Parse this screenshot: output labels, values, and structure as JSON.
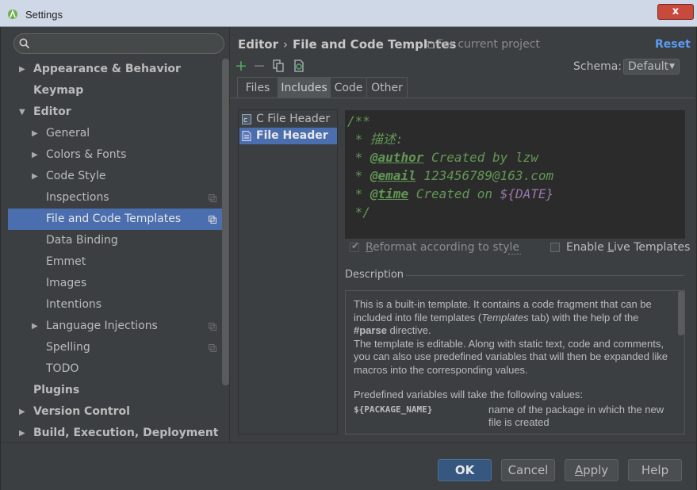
{
  "window": {
    "title": "Settings",
    "close_glyph": "x"
  },
  "search": {
    "placeholder": "",
    "value": ""
  },
  "tree": [
    {
      "label": "Appearance & Behavior",
      "bold": true,
      "arrow": "right"
    },
    {
      "label": "Keymap",
      "bold": true,
      "arrow": ""
    },
    {
      "label": "Editor",
      "bold": true,
      "arrow": "down"
    },
    {
      "label": "General",
      "bold": false,
      "arrow": "right"
    },
    {
      "label": "Colors & Fonts",
      "bold": false,
      "arrow": "right"
    },
    {
      "label": "Code Style",
      "bold": false,
      "arrow": "right"
    },
    {
      "label": "Inspections",
      "bold": false,
      "arrow": "",
      "project_icon": true
    },
    {
      "label": "File and Code Templates",
      "bold": false,
      "arrow": "",
      "project_icon": true,
      "selected": true
    },
    {
      "label": "Data Binding",
      "bold": false,
      "arrow": ""
    },
    {
      "label": "Emmet",
      "bold": false,
      "arrow": ""
    },
    {
      "label": "Images",
      "bold": false,
      "arrow": ""
    },
    {
      "label": "Intentions",
      "bold": false,
      "arrow": ""
    },
    {
      "label": "Language Injections",
      "bold": false,
      "arrow": "right",
      "project_icon": true
    },
    {
      "label": "Spelling",
      "bold": false,
      "arrow": "",
      "project_icon": true
    },
    {
      "label": "TODO",
      "bold": false,
      "arrow": ""
    },
    {
      "label": "Plugins",
      "bold": true,
      "arrow": ""
    },
    {
      "label": "Version Control",
      "bold": true,
      "arrow": "right"
    },
    {
      "label": "Build, Execution, Deployment",
      "bold": true,
      "arrow": "right"
    }
  ],
  "header": {
    "crumb_1": "Editor",
    "crumb_sep": "›",
    "crumb_2": "File and Code Templates",
    "scope": "For current project",
    "reset": "Reset"
  },
  "toolbar": {
    "add": "+",
    "remove": "−"
  },
  "schema": {
    "label": "Schema:",
    "value": "Default"
  },
  "tabs": [
    "Files",
    "Includes",
    "Code",
    "Other"
  ],
  "active_tab": "Includes",
  "templates": [
    {
      "label": "C File Header",
      "selected": false
    },
    {
      "label": "File Header",
      "selected": true
    }
  ],
  "editor": {
    "line1": "/**",
    "line2_prefix": " * ",
    "line2_text": "描述:",
    "line3_tag": "@author",
    "line3_text": " Created by lzw",
    "line4_tag": "@email",
    "line4_text": " 123456789@163.com",
    "line5_tag": "@time",
    "line5_text": " Created on ",
    "line5_var": "${DATE}",
    "line6": " */",
    "line_prefix": " * "
  },
  "options": {
    "reformat_label_u": "R",
    "reformat_label_rest": "eformat according to style",
    "reformat_checked": true,
    "live_label_pre": "Enable ",
    "live_label_u": "L",
    "live_label_rest": "ive Templates",
    "live_checked": false
  },
  "description": {
    "label": "Description",
    "p1_a": "This is a built-in template. It contains a code fragment that can be included into file templates (",
    "p1_em": "Templates",
    "p1_b": " tab) with the help of the ",
    "p1_strong": "#parse",
    "p1_c": " directive.",
    "p2": "The template is editable. Along with static text, code and comments, you can also use predefined variables that will then be expanded like macros into the corresponding values.",
    "p3": "Predefined variables will take the following values:",
    "var_name": "${PACKAGE_NAME}",
    "var_desc": "name of the package in which the new file is created"
  },
  "buttons": {
    "ok": "OK",
    "cancel": "Cancel",
    "apply_u": "A",
    "apply_rest": "pply",
    "help": "Help"
  },
  "colors": {
    "accent": "#4b6eaf",
    "link": "#589df6",
    "ok_button": "#365880",
    "comment": "#629755",
    "variable": "#9876aa"
  }
}
